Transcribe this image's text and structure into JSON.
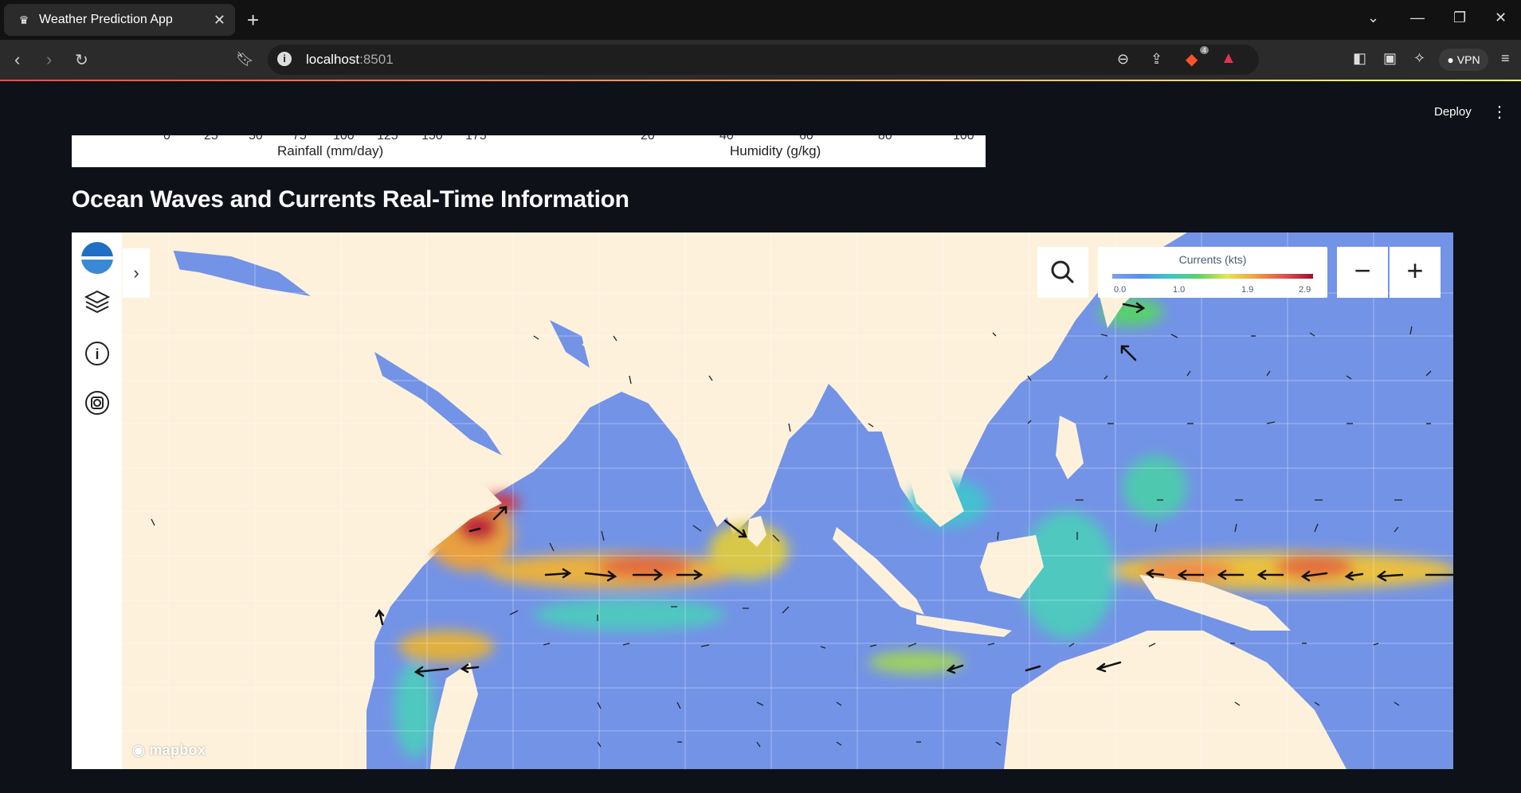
{
  "browser": {
    "tab_title": "Weather Prediction App",
    "tab_close": "✕",
    "new_tab": "+",
    "url_host": "localhost",
    "url_port": ":8501",
    "vpn_label": "VPN",
    "brave_badge": "4"
  },
  "app": {
    "deploy_label": "Deploy",
    "menu_glyph": "⋮"
  },
  "plot_strip": {
    "left_ticks": [
      "0",
      "25",
      "50",
      "75",
      "100",
      "125",
      "150",
      "175"
    ],
    "left_xlabel": "Rainfall (mm/day)",
    "right_ticks": [
      "20",
      "40",
      "60",
      "80",
      "100"
    ],
    "right_xlabel": "Humidity (g/kg)"
  },
  "section_title": "Ocean Waves and Currents Real-Time Information",
  "map": {
    "legend_title": "Currents (kts)",
    "legend_values": [
      "0.0",
      "1.0",
      "1.9",
      "2.9"
    ],
    "zoom_out": "−",
    "zoom_in": "+",
    "attribution": "mapbox",
    "colors": {
      "land": "#fdf1dc",
      "ocean_low": "#6f8fe8",
      "ocean_mid": "#44c6c0",
      "ocean_high": "#f0a040",
      "ocean_peak": "#c02040"
    }
  }
}
